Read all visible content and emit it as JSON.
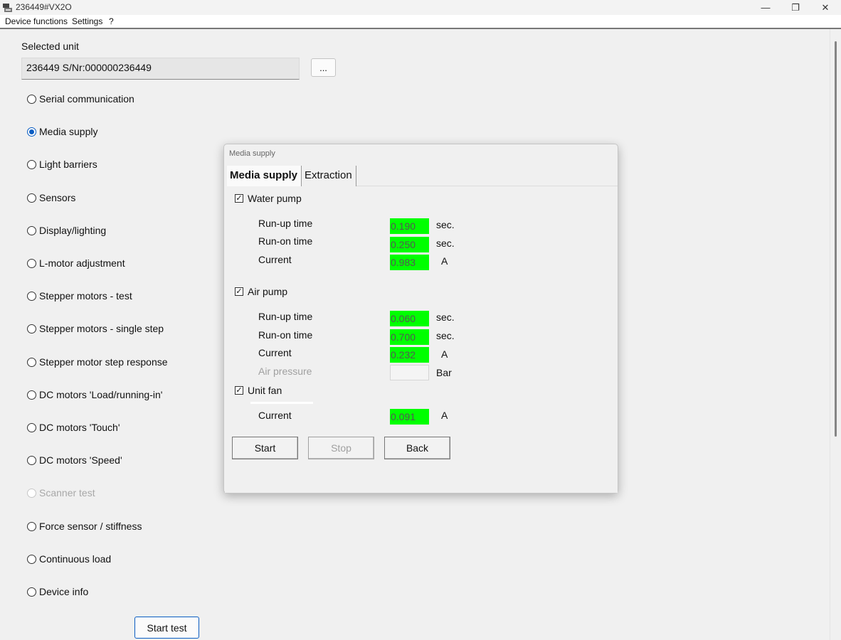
{
  "window": {
    "title": "236449#VX2O",
    "minimize_glyph": "—",
    "restore_glyph": "❐",
    "close_glyph": "✕"
  },
  "menu": {
    "items": [
      "Device functions",
      "Settings",
      "?"
    ]
  },
  "unit": {
    "label": "Selected unit",
    "value": "236449 S/Nr:000000236449",
    "browse_label": "..."
  },
  "tests": [
    {
      "label": "Serial communication",
      "checked": false,
      "enabled": true
    },
    {
      "label": "Media supply",
      "checked": true,
      "enabled": true
    },
    {
      "label": "Light barriers",
      "checked": false,
      "enabled": true
    },
    {
      "label": "Sensors",
      "checked": false,
      "enabled": true
    },
    {
      "label": "Display/lighting",
      "checked": false,
      "enabled": true
    },
    {
      "label": "L-motor adjustment",
      "checked": false,
      "enabled": true
    },
    {
      "label": "Stepper motors - test",
      "checked": false,
      "enabled": true
    },
    {
      "label": "Stepper motors - single step",
      "checked": false,
      "enabled": true
    },
    {
      "label": "Stepper motor step response",
      "checked": false,
      "enabled": true
    },
    {
      "label": "DC motors 'Load/running-in'",
      "checked": false,
      "enabled": true
    },
    {
      "label": "DC motors 'Touch'",
      "checked": false,
      "enabled": true
    },
    {
      "label": "DC motors 'Speed'",
      "checked": false,
      "enabled": true
    },
    {
      "label": "Scanner test",
      "checked": false,
      "enabled": false
    },
    {
      "label": "Force sensor / stiffness",
      "checked": false,
      "enabled": true
    },
    {
      "label": "Continuous load",
      "checked": false,
      "enabled": true
    },
    {
      "label": "Device info",
      "checked": false,
      "enabled": true
    }
  ],
  "start_test_label": "Start test",
  "dialog": {
    "title": "Media supply",
    "tabs": [
      {
        "label": "Media supply",
        "active": true
      },
      {
        "label": "Extraction",
        "active": false
      }
    ],
    "water_pump": {
      "label": "Water pump",
      "checked": true,
      "runup_label": "Run-up time",
      "runup_value": "0.190",
      "runup_unit": "sec.",
      "runon_label": "Run-on time",
      "runon_value": "0.250",
      "runon_unit": "sec.",
      "current_label": "Current",
      "current_value": "0.983",
      "current_unit": "A"
    },
    "air_pump": {
      "label": "Air pump",
      "checked": true,
      "runup_label": "Run-up time",
      "runup_value": "0.060",
      "runup_unit": "sec.",
      "runon_label": "Run-on time",
      "runon_value": "0.700",
      "runon_unit": "sec.",
      "current_label": "Current",
      "current_value": "0.232",
      "current_unit": "A",
      "pressure_label": "Air pressure",
      "pressure_value": "",
      "pressure_unit": "Bar"
    },
    "unit_fan": {
      "label": "Unit fan",
      "checked": true,
      "current_label": "Current",
      "current_value": "0.091",
      "current_unit": "A"
    },
    "buttons": {
      "start": "Start",
      "stop": "Stop",
      "back": "Back"
    },
    "value_ok_color": "#00ff00"
  }
}
